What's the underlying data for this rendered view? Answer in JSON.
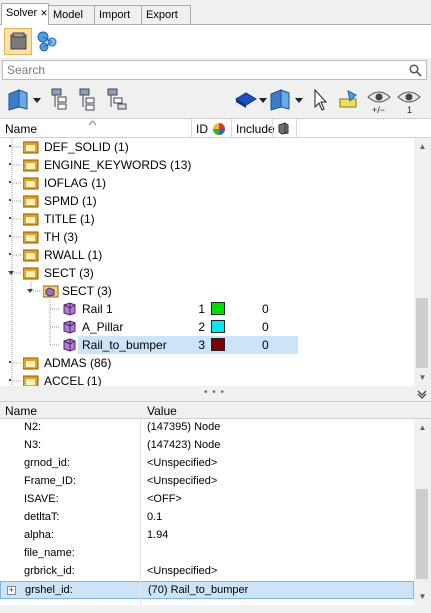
{
  "tabs": [
    {
      "label": "Solver",
      "close": "✕",
      "active": true
    },
    {
      "label": "Model",
      "active": false
    },
    {
      "label": "Import",
      "active": false
    },
    {
      "label": "Export",
      "active": false
    }
  ],
  "search": {
    "placeholder": "Search",
    "value": ""
  },
  "columns": {
    "name": "Name",
    "id": "ID",
    "include": "Include"
  },
  "tree": [
    {
      "label": "DEF_SOLID  (1)"
    },
    {
      "label": "ENGINE_KEYWORDS  (13)"
    },
    {
      "label": "IOFLAG  (1)"
    },
    {
      "label": "SPMD  (1)"
    },
    {
      "label": "TITLE  (1)"
    },
    {
      "label": "TH  (3)"
    },
    {
      "label": "RWALL  (1)"
    },
    {
      "label": "SECT  (3)"
    },
    {
      "label": "SECT  (3)"
    },
    {
      "label": "Rail 1",
      "id": "1",
      "color": "#00e000",
      "include": "0"
    },
    {
      "label": "A_Pillar",
      "id": "2",
      "color": "#00e8f0",
      "include": "0"
    },
    {
      "label": "Rail_to_bumper",
      "id": "3",
      "color": "#800000",
      "include": "0"
    },
    {
      "label": "ADMAS  (86)"
    },
    {
      "label": "ACCEL  (1)"
    }
  ],
  "properties": {
    "header_name": "Name",
    "header_value": "Value",
    "rows": [
      {
        "key": "N2:",
        "value": "(147395) Node"
      },
      {
        "key": "N3:",
        "value": "(147423) Node"
      },
      {
        "key": "grnod_id:",
        "value": "<Unspecified>"
      },
      {
        "key": "Frame_ID:",
        "value": "<Unspecified>"
      },
      {
        "key": "ISAVE:",
        "value": "<OFF>"
      },
      {
        "key": "detltaT:",
        "value": "0.1"
      },
      {
        "key": "alpha:",
        "value": "1.94"
      },
      {
        "key": "file_name:",
        "value": ""
      },
      {
        "key": "grbrick_id:",
        "value": "<Unspecified>"
      },
      {
        "key": "grshel_id:",
        "value": "(70) Rail_to_bumper"
      }
    ]
  },
  "splitter_grip": "• • •",
  "colors": {
    "selection": "#cce4f7",
    "folder": "#e8a020",
    "accent": "#1e5fb4"
  }
}
